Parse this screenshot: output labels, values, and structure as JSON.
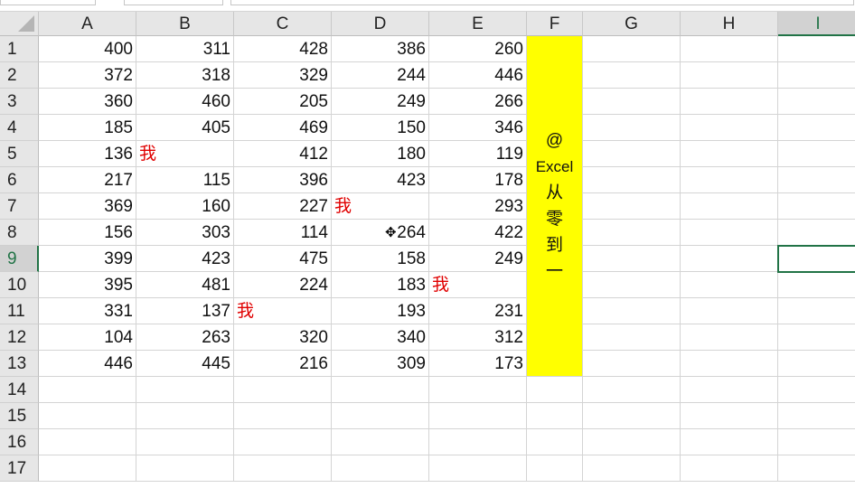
{
  "columns": [
    "A",
    "B",
    "C",
    "D",
    "E",
    "F",
    "G",
    "H",
    "I"
  ],
  "rows": [
    "1",
    "2",
    "3",
    "4",
    "5",
    "6",
    "7",
    "8",
    "9",
    "10",
    "11",
    "12",
    "13",
    "14",
    "15",
    "16",
    "17"
  ],
  "selected_cell": "I9",
  "cells": [
    [
      "400",
      "311",
      "428",
      "386",
      "260"
    ],
    [
      "372",
      "318",
      "329",
      "244",
      "446"
    ],
    [
      "360",
      "460",
      "205",
      "249",
      "266"
    ],
    [
      "185",
      "405",
      "469",
      "150",
      "346"
    ],
    [
      "136",
      "我",
      "412",
      "180",
      "119"
    ],
    [
      "217",
      "115",
      "396",
      "423",
      "178"
    ],
    [
      "369",
      "160",
      "227",
      "我",
      "293"
    ],
    [
      "156",
      "303",
      "114",
      "264",
      "422"
    ],
    [
      "399",
      "423",
      "475",
      "158",
      "249"
    ],
    [
      "395",
      "481",
      "224",
      "183",
      "我"
    ],
    [
      "331",
      "137",
      "我",
      "193",
      "231"
    ],
    [
      "104",
      "263",
      "320",
      "340",
      "312"
    ],
    [
      "446",
      "445",
      "216",
      "309",
      "173"
    ]
  ],
  "merged_f": [
    "@",
    "Excel",
    "从",
    "零",
    "到",
    "一"
  ],
  "colors": {
    "highlight": "#ffff00",
    "marker_text": "#e00000",
    "selection": "#217346"
  }
}
